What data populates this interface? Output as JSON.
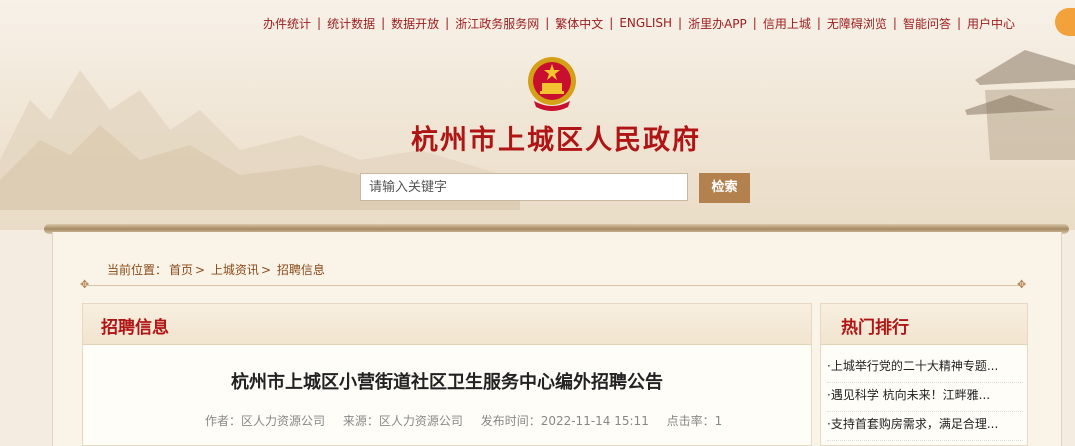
{
  "top_nav": [
    {
      "label": "办件统计"
    },
    {
      "label": "统计数据"
    },
    {
      "label": "数据开放"
    },
    {
      "label": "浙江政务服务网"
    },
    {
      "label": "繁体中文"
    },
    {
      "label": "ENGLISH"
    },
    {
      "label": "浙里办APP"
    },
    {
      "label": "信用上城"
    },
    {
      "label": "无障碍浏览"
    },
    {
      "label": "智能问答"
    },
    {
      "label": "用户中心"
    }
  ],
  "header": {
    "site_title": "杭州市上城区人民政府"
  },
  "search": {
    "placeholder": "请输入关键字",
    "button_label": "检索"
  },
  "breadcrumb": {
    "prefix": "当前位置：",
    "items": [
      "首页",
      "上城资讯",
      "招聘信息"
    ],
    "separator": ">"
  },
  "main": {
    "section_title": "招聘信息",
    "article_title": "杭州市上城区小营街道社区卫生服务中心编外招聘公告",
    "meta": {
      "author": "作者：区人力资源公司",
      "source": "来源：区人力资源公司",
      "published": "发布时间：2022-11-14 15:11",
      "clicks": "点击率：1"
    }
  },
  "sidebar": {
    "section_title": "热门排行",
    "items": [
      "·上城举行党的二十大精神专题...",
      "·遇见科学 杭向未来！江畔雅...",
      "·支持首套购房需求，满足合理..."
    ]
  },
  "colors": {
    "title_red": "#b01515",
    "button_brown": "#b3814e",
    "background": "#f4ece0"
  }
}
